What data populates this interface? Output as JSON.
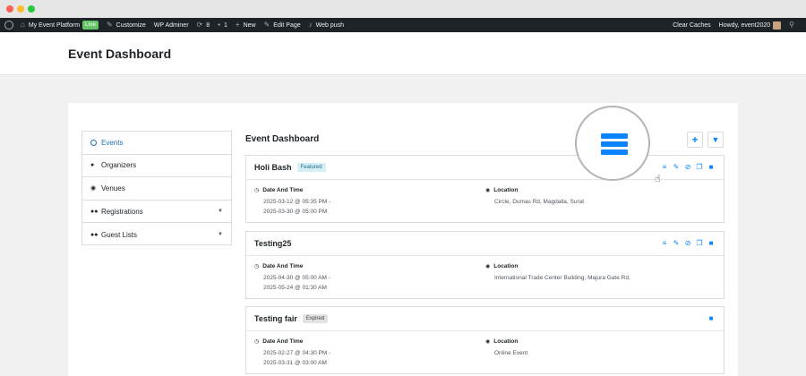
{
  "adminbar": {
    "site_name": "My Event Platform",
    "live_label": "Live",
    "customize": "Customize",
    "wp_adminer": "WP Adminer",
    "updates_count": "8",
    "comments_count": "1",
    "new": "New",
    "edit_page": "Edit Page",
    "web_push": "Web push",
    "clear_caches": "Clear Caches",
    "howdy": "Howdy, event2020"
  },
  "page": {
    "title": "Event Dashboard"
  },
  "sidebar": {
    "items": [
      {
        "label": "Events",
        "icon": "info-circle-icon"
      },
      {
        "label": "Organizers",
        "icon": "user-icon"
      },
      {
        "label": "Venues",
        "icon": "map-pin-icon"
      },
      {
        "label": "Registrations",
        "icon": "users-icon"
      },
      {
        "label": "Guest Lists",
        "icon": "users-icon"
      }
    ]
  },
  "content": {
    "title": "Event Dashboard"
  },
  "labels": {
    "date_time": "Date And Time",
    "location": "Location"
  },
  "events": [
    {
      "name": "Holi Bash",
      "badge": "Featured",
      "start": "2025-03-12 @ 05:35 PM -",
      "end": "2025-03-30 @ 05:00 PM",
      "location": "Circle, Dumas Rd, Magdalla, Surat"
    },
    {
      "name": "Testing25",
      "badge": "",
      "start": "2025-04-30 @ 05:00 AM -",
      "end": "2025-05-24 @ 01:30 AM",
      "location": "International Trade Center Building, Majura Gate Rd,"
    },
    {
      "name": "Testing fair",
      "badge": "Expired",
      "start": "2025-02-27 @ 04:30 PM -",
      "end": "2025-03-31 @ 03:00 AM",
      "location": "Online Event"
    }
  ],
  "colors": {
    "accent": "#0a84ff",
    "adminbar_bg": "#1d2327",
    "live": "#65c466",
    "featured_bg": "#d6eef5",
    "expired_bg": "#e3e3e3"
  }
}
